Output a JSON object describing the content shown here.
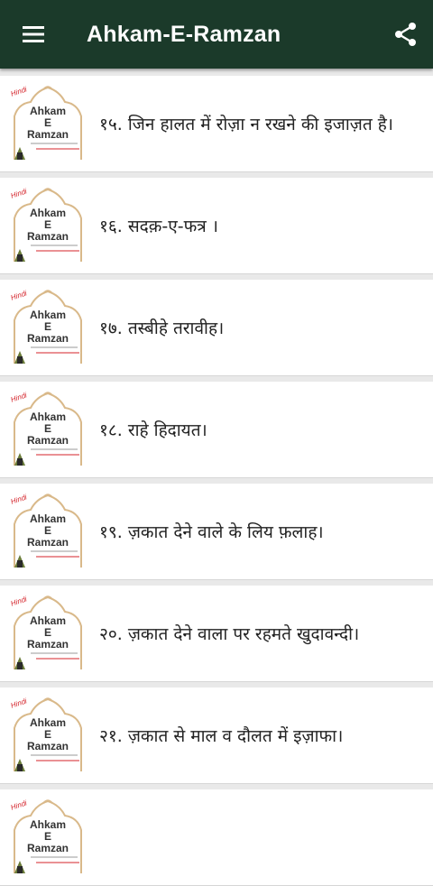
{
  "appbar": {
    "title": "Ahkam-E-Ramzan",
    "menu_icon": "hamburger-menu-icon",
    "share_icon": "share-icon",
    "background": "#1b3a2a"
  },
  "thumbnail": {
    "tag": "Hindi",
    "line1": "Ahkam",
    "line2": "E",
    "line3": "Ramzan",
    "tag_color": "#d4232a"
  },
  "items": [
    {
      "label": "१५. जिन हालत में रोज़ा न रखने की इजाज़त है।"
    },
    {
      "label": "१६. सदक़-ए-फत्र  ।"
    },
    {
      "label": "१७. तस्बीहे तरावीह।"
    },
    {
      "label": "१८. राहे हिदायत।"
    },
    {
      "label": "१९. ज़कात देने वाले के लिय फ़लाह।"
    },
    {
      "label": "२०. ज़कात देने वाला पर रहमते खुदावन्दी।"
    },
    {
      "label": "२१. ज़कात से माल व दौलत में इज़ाफा।"
    },
    {
      "label": ""
    }
  ]
}
